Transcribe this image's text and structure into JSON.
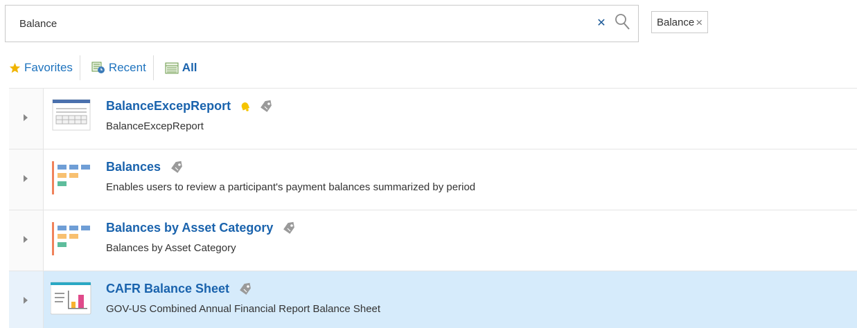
{
  "search": {
    "value": "Balance",
    "placeholder": ""
  },
  "filter_chip": {
    "label": "Balance"
  },
  "tabs": [
    {
      "label": "Favorites",
      "icon": "star-icon"
    },
    {
      "label": "Recent",
      "icon": "recent-icon"
    },
    {
      "label": "All",
      "icon": "all-icon"
    }
  ],
  "items": [
    {
      "title": "BalanceExcepReport",
      "description": "BalanceExcepReport",
      "icon": "report-table-icon",
      "has_notify": true,
      "selected": false
    },
    {
      "title": "Balances",
      "description": "Enables users to review a participant's payment balances summarized by period",
      "icon": "layout-blocks-icon",
      "has_notify": false,
      "selected": false
    },
    {
      "title": "Balances by Asset Category",
      "description": "Balances by Asset Category",
      "icon": "layout-blocks-icon",
      "has_notify": false,
      "selected": false
    },
    {
      "title": "CAFR Balance Sheet",
      "description": "GOV-US Combined Annual Financial Report Balance Sheet",
      "icon": "dashboard-chart-icon",
      "has_notify": false,
      "selected": true
    }
  ],
  "colors": {
    "link": "#1a63ad",
    "selected_row": "#d6ebfb",
    "star": "#f0b400"
  }
}
